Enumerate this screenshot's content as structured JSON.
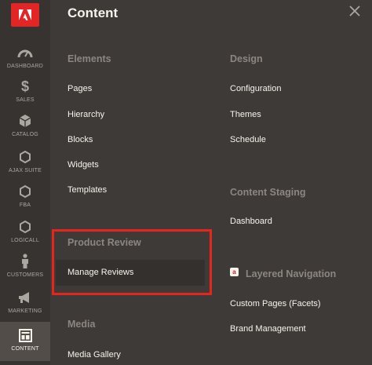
{
  "sidebar": {
    "items": [
      {
        "label": "DASHBOARD",
        "icon": "dashboard-icon"
      },
      {
        "label": "SALES",
        "icon": "dollar-icon"
      },
      {
        "label": "CATALOG",
        "icon": "cube-icon"
      },
      {
        "label": "AJAX SUITE",
        "icon": "hexagon-icon"
      },
      {
        "label": "FBA",
        "icon": "hexagon-icon"
      },
      {
        "label": "LOGICALL",
        "icon": "hexagon-icon"
      },
      {
        "label": "CUSTOMERS",
        "icon": "person-icon"
      },
      {
        "label": "MARKETING",
        "icon": "megaphone-icon"
      },
      {
        "label": "CONTENT",
        "icon": "layout-icon",
        "active": true
      }
    ]
  },
  "panel": {
    "title": "Content",
    "elements": {
      "title": "Elements",
      "links": [
        "Pages",
        "Hierarchy",
        "Blocks",
        "Widgets",
        "Templates"
      ]
    },
    "design": {
      "title": "Design",
      "links": [
        "Configuration",
        "Themes",
        "Schedule"
      ]
    },
    "content_staging": {
      "title": "Content Staging",
      "links": [
        "Dashboard"
      ]
    },
    "product_review": {
      "title": "Product Review",
      "links": [
        "Manage Reviews"
      ]
    },
    "layered_navigation": {
      "title": "Layered Navigation",
      "links": [
        "Custom Pages (Facets)",
        "Brand Management"
      ]
    },
    "media": {
      "title": "Media",
      "links": [
        "Media Gallery"
      ]
    }
  },
  "colors": {
    "sidebar_bg": "#373330",
    "panel_bg": "#3d3a38",
    "highlight": "#e5261f",
    "brand_red": "#e22626"
  }
}
